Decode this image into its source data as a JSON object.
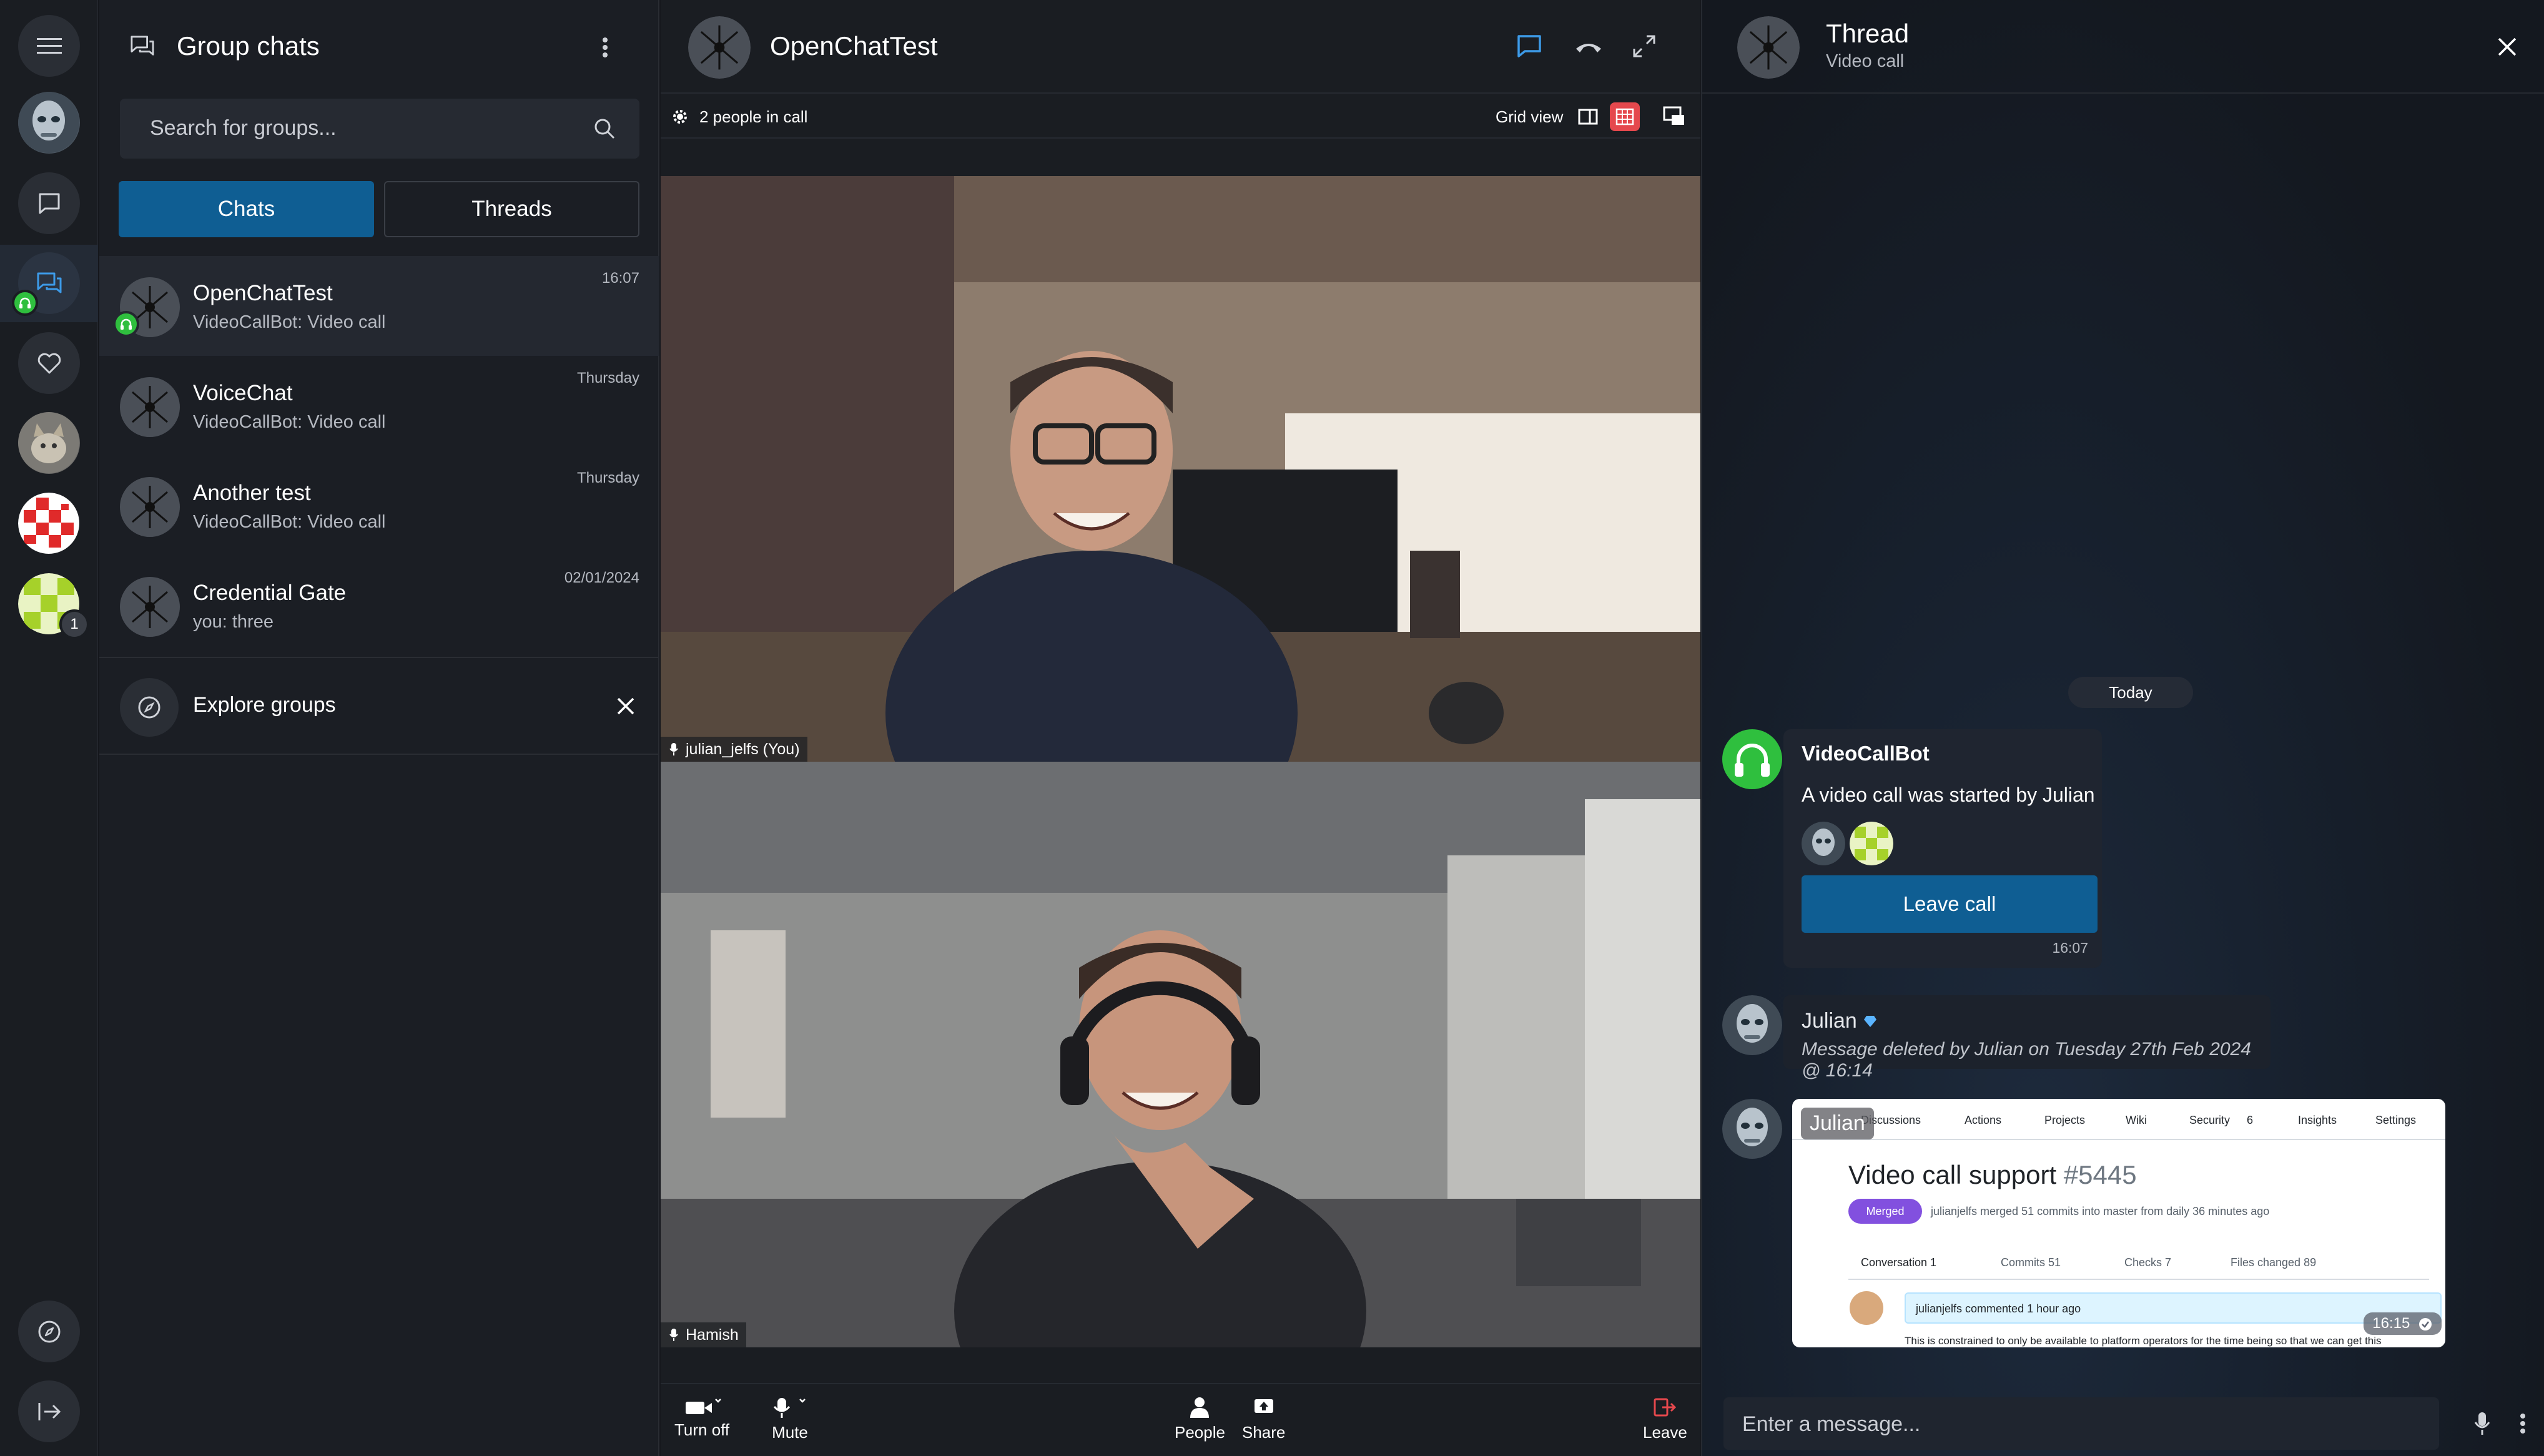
{
  "rail": {
    "unread_count": "1"
  },
  "groups": {
    "title": "Group chats",
    "search_placeholder": "Search for groups...",
    "tabs": {
      "chats": "Chats",
      "threads": "Threads"
    },
    "items": [
      {
        "name": "OpenChatTest",
        "sub": "VideoCallBot: Video call",
        "time": "16:07"
      },
      {
        "name": "VoiceChat",
        "sub": "VideoCallBot: Video call",
        "time": "Thursday"
      },
      {
        "name": "Another test",
        "sub": "VideoCallBot: Video call",
        "time": "Thursday"
      },
      {
        "name": "Credential Gate",
        "sub": "you: three",
        "time": "02/01/2024"
      }
    ],
    "explore": "Explore groups"
  },
  "call": {
    "title": "OpenChatTest",
    "people_in_call": "2 people in call",
    "grid_view": "Grid view",
    "participants": [
      "julian_jelfs (You)",
      "Hamish"
    ],
    "controls": {
      "turn_off": "Turn off",
      "mute": "Mute",
      "people": "People",
      "share": "Share",
      "leave": "Leave"
    }
  },
  "thread": {
    "title": "Thread",
    "subtitle": "Video call",
    "today": "Today",
    "bot_message": {
      "sender": "VideoCallBot",
      "text": "A video call was started by Julian",
      "button": "Leave call",
      "time": "16:07"
    },
    "deleted_message": {
      "sender": "Julian",
      "text": "Message deleted by Julian on Tuesday 27th Feb 2024 @ 16:14"
    },
    "image_message": {
      "sender": "Julian",
      "time": "16:15",
      "screenshot": {
        "tabs": [
          "Discussions",
          "Actions",
          "Projects",
          "Wiki",
          "Security",
          "Insights",
          "Settings"
        ],
        "security_count": "6",
        "pr_title": "Video call support",
        "pr_number": "#5445",
        "status": "Merged",
        "meta": "julianjelfs merged 51 commits into master from daily 36 minutes ago",
        "subtabs": [
          "Conversation 1",
          "Commits 51",
          "Checks 7",
          "Files changed 89"
        ],
        "comment_header": "julianjelfs commented 1 hour ago",
        "comment_text": "This is constrained to only be available to platform operators for the time being so that we can get this"
      }
    },
    "composer_placeholder": "Enter a message..."
  },
  "colors": {
    "accent": "#0f5e93",
    "bot_green": "#2fbf3e",
    "leave_red": "#e5484d"
  }
}
